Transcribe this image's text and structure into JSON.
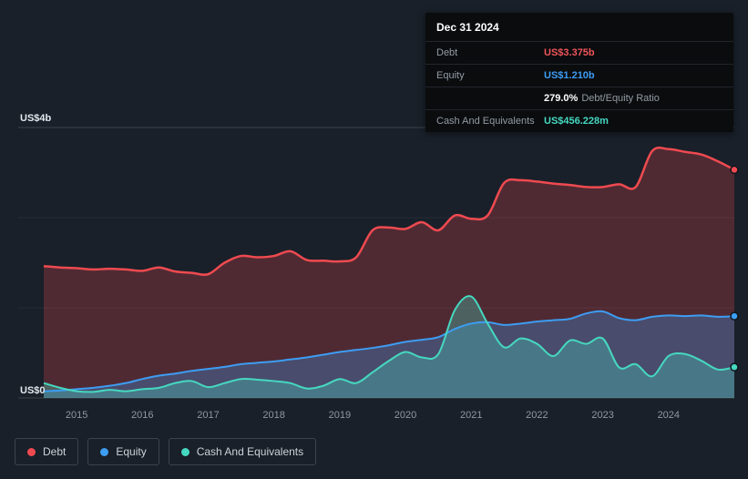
{
  "tooltip": {
    "date": "Dec 31 2024",
    "debt_label": "Debt",
    "debt_value": "US$3.375b",
    "equity_label": "Equity",
    "equity_value": "US$1.210b",
    "ratio_value": "279.0%",
    "ratio_label": "Debt/Equity Ratio",
    "cash_label": "Cash And Equivalents",
    "cash_value": "US$456.228m"
  },
  "legend": {
    "debt": "Debt",
    "equity": "Equity",
    "cash": "Cash And Equivalents"
  },
  "colors": {
    "background": "#192029",
    "debt": "#ef4a50",
    "equity": "#3d9df3",
    "cash": "#46d8c0",
    "tick_text": "#8e98a3",
    "axis_text": "#e3e8ed"
  },
  "chart_data": {
    "type": "area",
    "y_axis": {
      "top_label": "US$4b",
      "bottom_label": "US$0",
      "min": 0,
      "max": 4,
      "unit": "US$ billions"
    },
    "x_ticks": [
      2015,
      2016,
      2017,
      2018,
      2019,
      2020,
      2021,
      2022,
      2023,
      2024
    ],
    "x_range": [
      2014.5,
      2025.0
    ],
    "x": [
      2014.5,
      2014.75,
      2015.0,
      2015.25,
      2015.5,
      2015.75,
      2016.0,
      2016.25,
      2016.5,
      2016.75,
      2017.0,
      2017.25,
      2017.5,
      2017.75,
      2018.0,
      2018.25,
      2018.5,
      2018.75,
      2019.0,
      2019.25,
      2019.5,
      2019.75,
      2020.0,
      2020.25,
      2020.5,
      2020.75,
      2021.0,
      2021.25,
      2021.5,
      2021.75,
      2022.0,
      2022.25,
      2022.5,
      2022.75,
      2023.0,
      2023.25,
      2023.5,
      2023.75,
      2024.0,
      2024.25,
      2024.5,
      2024.75,
      2025.0
    ],
    "series": [
      {
        "name": "Debt",
        "color": "#ef4a50",
        "values": [
          1.95,
          1.93,
          1.92,
          1.9,
          1.91,
          1.9,
          1.88,
          1.93,
          1.87,
          1.85,
          1.83,
          2.0,
          2.1,
          2.08,
          2.1,
          2.17,
          2.04,
          2.03,
          2.02,
          2.08,
          2.48,
          2.52,
          2.5,
          2.6,
          2.48,
          2.7,
          2.65,
          2.7,
          3.18,
          3.22,
          3.2,
          3.17,
          3.15,
          3.12,
          3.12,
          3.16,
          3.12,
          3.65,
          3.68,
          3.64,
          3.6,
          3.5,
          3.375
        ]
      },
      {
        "name": "Equity",
        "color": "#3d9df3",
        "values": [
          0.1,
          0.11,
          0.13,
          0.15,
          0.18,
          0.22,
          0.28,
          0.33,
          0.36,
          0.4,
          0.43,
          0.46,
          0.5,
          0.52,
          0.54,
          0.57,
          0.6,
          0.64,
          0.68,
          0.71,
          0.74,
          0.78,
          0.83,
          0.86,
          0.9,
          1.02,
          1.1,
          1.12,
          1.08,
          1.1,
          1.13,
          1.15,
          1.17,
          1.25,
          1.28,
          1.18,
          1.15,
          1.2,
          1.22,
          1.21,
          1.22,
          1.2,
          1.21
        ]
      },
      {
        "name": "Cash And Equivalents",
        "color": "#46d8c0",
        "values": [
          0.22,
          0.15,
          0.1,
          0.09,
          0.12,
          0.1,
          0.13,
          0.15,
          0.22,
          0.25,
          0.16,
          0.22,
          0.28,
          0.27,
          0.25,
          0.22,
          0.14,
          0.18,
          0.28,
          0.22,
          0.38,
          0.55,
          0.68,
          0.6,
          0.65,
          1.3,
          1.5,
          1.1,
          0.75,
          0.88,
          0.8,
          0.62,
          0.85,
          0.8,
          0.88,
          0.45,
          0.5,
          0.32,
          0.62,
          0.65,
          0.55,
          0.42,
          0.456
        ]
      }
    ]
  }
}
